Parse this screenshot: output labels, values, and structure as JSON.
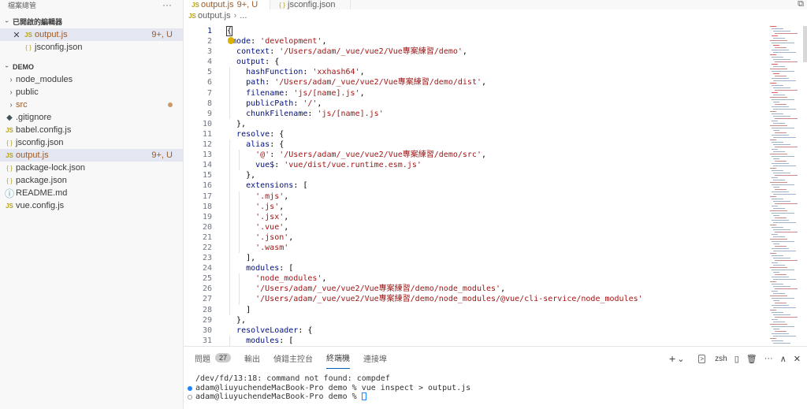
{
  "sidebar": {
    "title": "檔案總管",
    "more": "···",
    "open_editors": {
      "title": "已開啟的編輯器",
      "items": [
        {
          "name": "output.js",
          "icon": "JS",
          "status": "9+, U",
          "close": "✕"
        },
        {
          "name": "jsconfig.json",
          "icon": "{ }"
        }
      ]
    },
    "project": {
      "title": "DEMO",
      "items": [
        {
          "name": "node_modules",
          "chevron": "›"
        },
        {
          "name": "public",
          "chevron": "›"
        },
        {
          "name": "src",
          "chevron": "›"
        },
        {
          "name": ".gitignore",
          "icon": "◆"
        },
        {
          "name": "babel.config.js",
          "icon": "JS"
        },
        {
          "name": "jsconfig.json",
          "icon": "{ }"
        },
        {
          "name": "output.js",
          "icon": "JS",
          "status": "9+, U"
        },
        {
          "name": "package-lock.json",
          "icon": "{ }"
        },
        {
          "name": "package.json",
          "icon": "{ }"
        },
        {
          "name": "README.md",
          "icon": "ⓘ"
        },
        {
          "name": "vue.config.js",
          "icon": "JS"
        }
      ]
    }
  },
  "tabs": [
    {
      "label": "output.js",
      "icon": "JS",
      "state": "9+, U",
      "close": "✕"
    },
    {
      "label": "jsconfig.json",
      "icon": "{ }"
    }
  ],
  "breadcrumb": {
    "file": "output.js",
    "icon": "JS",
    "sep": "›",
    "rest": "..."
  },
  "colors": {
    "string": "#a31515",
    "property": "#001080",
    "modified": "#9a5c29",
    "accent": "#005fb8",
    "selection": "#e4e6f1"
  },
  "code_lines": [
    {
      "n": "1",
      "indent": 0,
      "parts": [
        [
          "p",
          "{"
        ]
      ]
    },
    {
      "n": "2",
      "indent": 0,
      "parts": [
        [
          "p",
          " "
        ],
        [
          "k",
          "mode"
        ],
        [
          "p",
          ": "
        ],
        [
          "s",
          "'development'"
        ],
        [
          "p",
          ","
        ]
      ]
    },
    {
      "n": "3",
      "indent": 0,
      "parts": [
        [
          "p",
          "  "
        ],
        [
          "k",
          "context"
        ],
        [
          "p",
          ": "
        ],
        [
          "s",
          "'/Users/adam/_vue/vue2/Vue專案練習/demo'"
        ],
        [
          "p",
          ","
        ]
      ]
    },
    {
      "n": "4",
      "indent": 0,
      "parts": [
        [
          "p",
          "  "
        ],
        [
          "k",
          "output"
        ],
        [
          "p",
          ": {"
        ]
      ]
    },
    {
      "n": "5",
      "indent": 1,
      "parts": [
        [
          "p",
          "    "
        ],
        [
          "k",
          "hashFunction"
        ],
        [
          "p",
          ": "
        ],
        [
          "s",
          "'xxhash64'"
        ],
        [
          "p",
          ","
        ]
      ]
    },
    {
      "n": "6",
      "indent": 1,
      "parts": [
        [
          "p",
          "    "
        ],
        [
          "k",
          "path"
        ],
        [
          "p",
          ": "
        ],
        [
          "s",
          "'/Users/adam/_vue/vue2/Vue專案練習/demo/dist'"
        ],
        [
          "p",
          ","
        ]
      ]
    },
    {
      "n": "7",
      "indent": 1,
      "parts": [
        [
          "p",
          "    "
        ],
        [
          "k",
          "filename"
        ],
        [
          "p",
          ": "
        ],
        [
          "s",
          "'js/[name].js'"
        ],
        [
          "p",
          ","
        ]
      ]
    },
    {
      "n": "8",
      "indent": 1,
      "parts": [
        [
          "p",
          "    "
        ],
        [
          "k",
          "publicPath"
        ],
        [
          "p",
          ": "
        ],
        [
          "s",
          "'/'"
        ],
        [
          "p",
          ","
        ]
      ]
    },
    {
      "n": "9",
      "indent": 1,
      "parts": [
        [
          "p",
          "    "
        ],
        [
          "k",
          "chunkFilename"
        ],
        [
          "p",
          ": "
        ],
        [
          "s",
          "'js/[name].js'"
        ]
      ]
    },
    {
      "n": "10",
      "indent": 0,
      "parts": [
        [
          "p",
          "  },"
        ]
      ]
    },
    {
      "n": "11",
      "indent": 0,
      "parts": [
        [
          "p",
          "  "
        ],
        [
          "k",
          "resolve"
        ],
        [
          "p",
          ": {"
        ]
      ]
    },
    {
      "n": "12",
      "indent": 1,
      "parts": [
        [
          "p",
          "    "
        ],
        [
          "k",
          "alias"
        ],
        [
          "p",
          ": {"
        ]
      ]
    },
    {
      "n": "13",
      "indent": 2,
      "parts": [
        [
          "p",
          "      "
        ],
        [
          "s",
          "'@'"
        ],
        [
          "p",
          ": "
        ],
        [
          "s",
          "'/Users/adam/_vue/vue2/Vue專案練習/demo/src'"
        ],
        [
          "p",
          ","
        ]
      ]
    },
    {
      "n": "14",
      "indent": 2,
      "parts": [
        [
          "p",
          "      "
        ],
        [
          "k",
          "vue$"
        ],
        [
          "p",
          ": "
        ],
        [
          "s",
          "'vue/dist/vue.runtime.esm.js'"
        ]
      ]
    },
    {
      "n": "15",
      "indent": 1,
      "parts": [
        [
          "p",
          "    },"
        ]
      ]
    },
    {
      "n": "16",
      "indent": 1,
      "parts": [
        [
          "p",
          "    "
        ],
        [
          "k",
          "extensions"
        ],
        [
          "p",
          ": ["
        ]
      ]
    },
    {
      "n": "17",
      "indent": 2,
      "parts": [
        [
          "p",
          "      "
        ],
        [
          "s",
          "'.mjs'"
        ],
        [
          "p",
          ","
        ]
      ]
    },
    {
      "n": "18",
      "indent": 2,
      "parts": [
        [
          "p",
          "      "
        ],
        [
          "s",
          "'.js'"
        ],
        [
          "p",
          ","
        ]
      ]
    },
    {
      "n": "19",
      "indent": 2,
      "parts": [
        [
          "p",
          "      "
        ],
        [
          "s",
          "'.jsx'"
        ],
        [
          "p",
          ","
        ]
      ]
    },
    {
      "n": "20",
      "indent": 2,
      "parts": [
        [
          "p",
          "      "
        ],
        [
          "s",
          "'.vue'"
        ],
        [
          "p",
          ","
        ]
      ]
    },
    {
      "n": "21",
      "indent": 2,
      "parts": [
        [
          "p",
          "      "
        ],
        [
          "s",
          "'.json'"
        ],
        [
          "p",
          ","
        ]
      ]
    },
    {
      "n": "22",
      "indent": 2,
      "parts": [
        [
          "p",
          "      "
        ],
        [
          "s",
          "'.wasm'"
        ]
      ]
    },
    {
      "n": "23",
      "indent": 1,
      "parts": [
        [
          "p",
          "    ],"
        ]
      ]
    },
    {
      "n": "24",
      "indent": 1,
      "parts": [
        [
          "p",
          "    "
        ],
        [
          "k",
          "modules"
        ],
        [
          "p",
          ": ["
        ]
      ]
    },
    {
      "n": "25",
      "indent": 2,
      "parts": [
        [
          "p",
          "      "
        ],
        [
          "s",
          "'node_modules'"
        ],
        [
          "p",
          ","
        ]
      ]
    },
    {
      "n": "26",
      "indent": 2,
      "parts": [
        [
          "p",
          "      "
        ],
        [
          "s",
          "'/Users/adam/_vue/vue2/Vue專案練習/demo/node_modules'"
        ],
        [
          "p",
          ","
        ]
      ]
    },
    {
      "n": "27",
      "indent": 2,
      "parts": [
        [
          "p",
          "      "
        ],
        [
          "s",
          "'/Users/adam/_vue/vue2/Vue專案練習/demo/node_modules/@vue/cli-service/node_modules'"
        ]
      ]
    },
    {
      "n": "28",
      "indent": 1,
      "parts": [
        [
          "p",
          "    ]"
        ]
      ]
    },
    {
      "n": "29",
      "indent": 0,
      "parts": [
        [
          "p",
          "  },"
        ]
      ]
    },
    {
      "n": "30",
      "indent": 0,
      "parts": [
        [
          "p",
          "  "
        ],
        [
          "k",
          "resolveLoader"
        ],
        [
          "p",
          ": {"
        ]
      ]
    },
    {
      "n": "31",
      "indent": 1,
      "parts": [
        [
          "p",
          "    "
        ],
        [
          "k",
          "modules"
        ],
        [
          "p",
          ": ["
        ]
      ]
    }
  ],
  "panel": {
    "tabs": [
      {
        "label": "問題",
        "badge": "27"
      },
      {
        "label": "輸出"
      },
      {
        "label": "偵錯主控台"
      },
      {
        "label": "終端機",
        "active": true
      },
      {
        "label": "連接埠"
      }
    ],
    "tools": {
      "add": "+",
      "add_menu": "⌄",
      "shell_icon": ">",
      "shell": "zsh",
      "split": "▯",
      "trash": "🗑",
      "more": "···",
      "maximize": "∧",
      "close": "✕"
    },
    "terminal_lines": [
      {
        "text": "/dev/fd/13:18: command not found: compdef",
        "dot": ""
      },
      {
        "text": "adam@liuyuchendeMacBook-Pro demo % vue inspect > output.js",
        "dot": "filled"
      },
      {
        "text": "adam@liuyuchendeMacBook-Pro demo % ",
        "dot": "hollow",
        "cursor": true
      }
    ]
  },
  "toolbar_icon": "⧉"
}
